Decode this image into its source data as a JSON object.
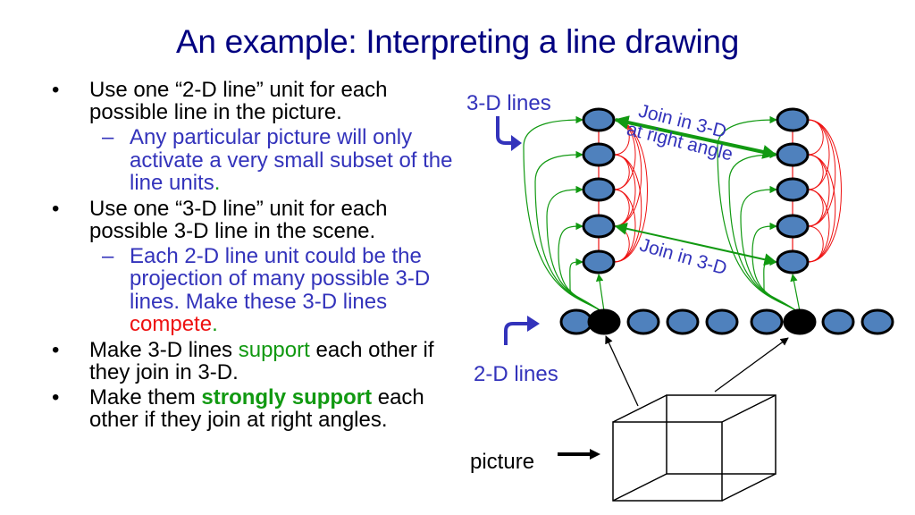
{
  "slide": {
    "title": "An example: Interpreting a line drawing",
    "bullets": [
      {
        "bullet_glyph": "•",
        "text_parts": [
          "Use one ",
          "“2-D line”",
          " unit for each possible line in the picture."
        ],
        "subbullets": [
          {
            "dash_glyph": "–",
            "text": "Any particular picture will only activate a very small subset of the line units",
            "end": "."
          }
        ]
      },
      {
        "bullet_glyph": "•",
        "text_parts": [
          "Use one ",
          "“3-D line”",
          " unit for each possible 3-D line in the scene."
        ],
        "subbullets": [
          {
            "dash_glyph": "–",
            "text": "Each 2-D line unit could be the projection of many possible 3-D lines. Make these 3-D lines ",
            "highlight": "compete",
            "end": "."
          }
        ]
      },
      {
        "bullet_glyph": "•",
        "before": "Make 3-D lines ",
        "highlight": "support",
        "after": " each other if they join in 3-D."
      },
      {
        "bullet_glyph": "•",
        "before": "Make them ",
        "highlight": "strongly support",
        "after": " each other if they join at right angles."
      }
    ]
  },
  "diagram": {
    "labels": {
      "three_d_lines": "3-D lines",
      "two_d_lines": "2-D lines",
      "picture": "picture",
      "join_right_angle_line1": "Join in 3-D",
      "join_right_angle_line2": "at right angle",
      "join_3d": "Join in 3-D"
    },
    "three_d_columns": 2,
    "units_per_column": 5,
    "two_d_units": 9,
    "active_two_d_units": [
      2,
      7
    ],
    "colors": {
      "unit_fill": "#4f81bd",
      "active_fill": "#000000",
      "support": "#119911",
      "compete": "#ee1111",
      "label": "#3333bb"
    }
  }
}
